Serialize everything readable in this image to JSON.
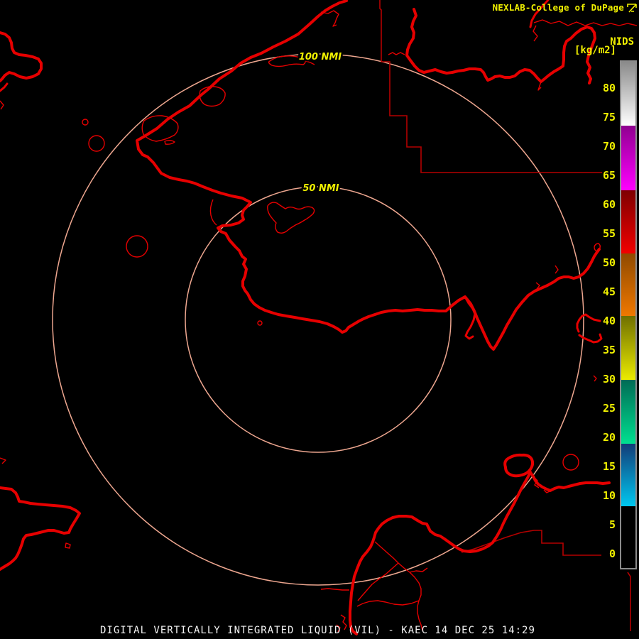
{
  "header": {
    "title": "NEXLAB-College of DuPage",
    "nids_label": "NIDS",
    "units_label": "[kg/m2]",
    "text_color": "#f0f000"
  },
  "range_rings": {
    "outer_label": "100 NMI",
    "inner_label": "50 NMI",
    "ring_color": "#eda68f",
    "label_color": "#f0f000"
  },
  "map": {
    "coastline_color": "#e60000",
    "boundary_color": "#b40000",
    "background_color": "#000000"
  },
  "colorbar": {
    "units": "kg/m2",
    "border_color": "#8c8c8c",
    "label_color": "#f0f000",
    "ticks": [
      {
        "value": 80,
        "label": "80"
      },
      {
        "value": 75,
        "label": "75"
      },
      {
        "value": 70,
        "label": "70"
      },
      {
        "value": 65,
        "label": "65"
      },
      {
        "value": 60,
        "label": "60"
      },
      {
        "value": 55,
        "label": "55"
      },
      {
        "value": 50,
        "label": "50"
      },
      {
        "value": 45,
        "label": "45"
      },
      {
        "value": 40,
        "label": "40"
      },
      {
        "value": 35,
        "label": "35"
      },
      {
        "value": 30,
        "label": "30"
      },
      {
        "value": 25,
        "label": "25"
      },
      {
        "value": 20,
        "label": "20"
      },
      {
        "value": 15,
        "label": "15"
      },
      {
        "value": 10,
        "label": "10"
      },
      {
        "value": 5,
        "label": "5"
      },
      {
        "value": 0,
        "label": "0"
      }
    ],
    "segments": [
      {
        "approx_range": "74-84",
        "colors": [
          "#8a8a8a",
          "#ffffff"
        ]
      },
      {
        "approx_range": "63-74",
        "colors": [
          "#8f008f",
          "#ff00ff"
        ]
      },
      {
        "approx_range": "52-63",
        "colors": [
          "#7e0000",
          "#f20000"
        ]
      },
      {
        "approx_range": "41-52",
        "colors": [
          "#8f4a00",
          "#f07800"
        ]
      },
      {
        "approx_range": "30-41",
        "colors": [
          "#6f6f00",
          "#ebeb00"
        ]
      },
      {
        "approx_range": "19-30",
        "colors": [
          "#006b55",
          "#00e090"
        ]
      },
      {
        "approx_range": "8-19",
        "colors": [
          "#123c78",
          "#00c8f0"
        ]
      },
      {
        "approx_range": "0-8",
        "colors": [
          "#000000",
          "#000000"
        ]
      }
    ]
  },
  "status_bar": {
    "text": "DIGITAL VERTICALLY INTEGRATED LIQUID (VIL) - KAEC 14 DEC 25 14:29",
    "product": "DIGITAL VERTICALLY INTEGRATED LIQUID (VIL)",
    "station": "KAEC",
    "datetime": "14 DEC 25 14:29"
  }
}
